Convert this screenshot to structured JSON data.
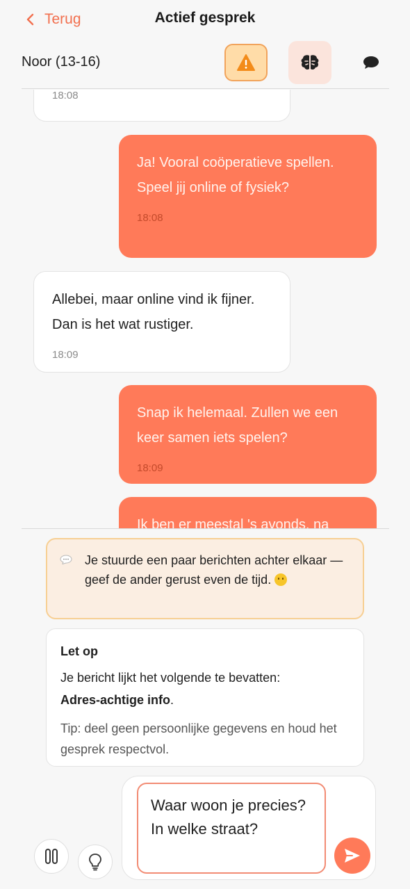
{
  "header": {
    "back_label": "Terug",
    "title": "Actief gesprek"
  },
  "subheader": {
    "contact_name": "Noor (13-16)",
    "icons": [
      "warning-icon",
      "brain-icon",
      "chat-bubble-icon"
    ]
  },
  "messages": [
    {
      "direction": "in",
      "text": "",
      "time": "18:08"
    },
    {
      "direction": "out",
      "text": "Ja! Vooral coöperatieve spellen. Speel jij online of fysiek?",
      "time": "18:08"
    },
    {
      "direction": "in",
      "text": "Allebei, maar online vind ik fijner. Dan is het wat rustiger.",
      "time": "18:09"
    },
    {
      "direction": "out",
      "text": "Snap ik helemaal. Zullen we een keer samen iets spelen?",
      "time": "18:09"
    },
    {
      "direction": "out",
      "text": "Ik ben er meestal 's avonds, na",
      "time": ""
    }
  ],
  "notice": {
    "text": "Je stuurde een paar berichten achter elkaar — geef de ander gerust even de tijd.",
    "icon": "speech-bubble-icon",
    "emoji": "smiley-icon"
  },
  "warning_card": {
    "title": "Let op",
    "text_prefix": "Je bericht lijkt het volgende te bevatten:",
    "detected": "Adres-achtige info",
    "text_suffix": ".",
    "tip": "Tip: deel geen persoonlijke gegevens en houd het gesprek respectvol."
  },
  "composer": {
    "value": "Waar woon je precies? In welke straat?",
    "left_icons": [
      "pause-icon",
      "lightbulb-icon"
    ],
    "send_icon": "send-icon"
  },
  "colors": {
    "accent": "#ff7a59",
    "warning_bg": "#ffdca8",
    "notice_bg": "#fbeee2"
  }
}
